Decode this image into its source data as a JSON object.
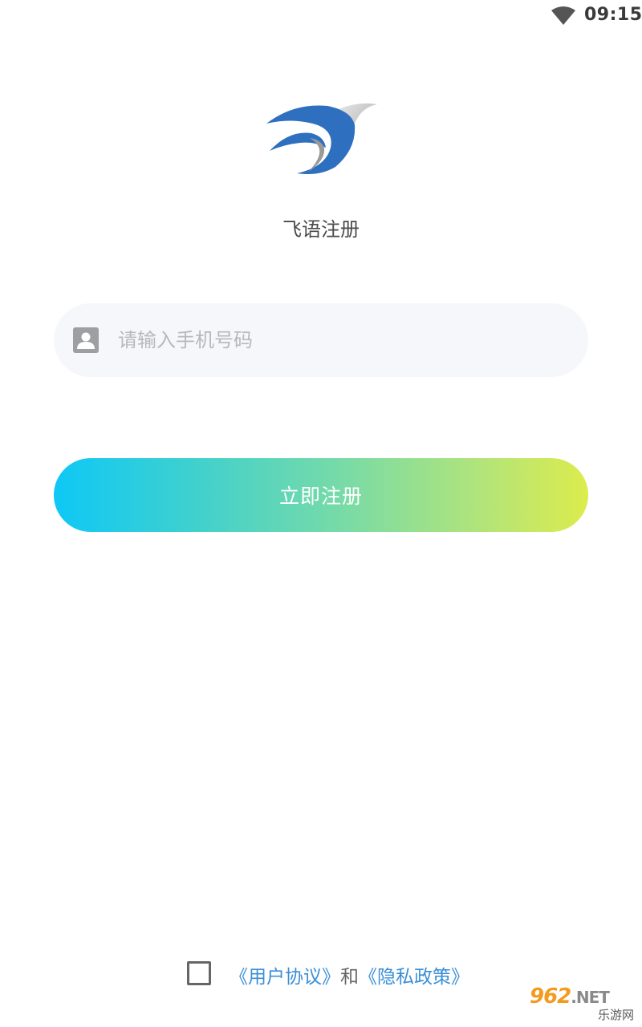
{
  "status_bar": {
    "time": "09:15",
    "wifi_icon": "wifi-icon"
  },
  "header": {
    "logo_icon": "bird-logo-icon",
    "title": "飞语注册"
  },
  "form": {
    "phone_placeholder": "请输入手机号码",
    "phone_value": "",
    "user_icon": "user-card-icon",
    "register_label": "立即注册"
  },
  "agreement": {
    "checked": false,
    "user_agreement": "《用户协议》",
    "and_text": "和",
    "privacy_policy": "《隐私政策》"
  },
  "watermark": {
    "brand": "962",
    "domain": ".NET",
    "site_name": "乐游网"
  },
  "colors": {
    "gradient_start": "#0ec8f6",
    "gradient_end": "#dcec4c",
    "link": "#3a8fd6",
    "logo_blue": "#2f6fbf"
  }
}
